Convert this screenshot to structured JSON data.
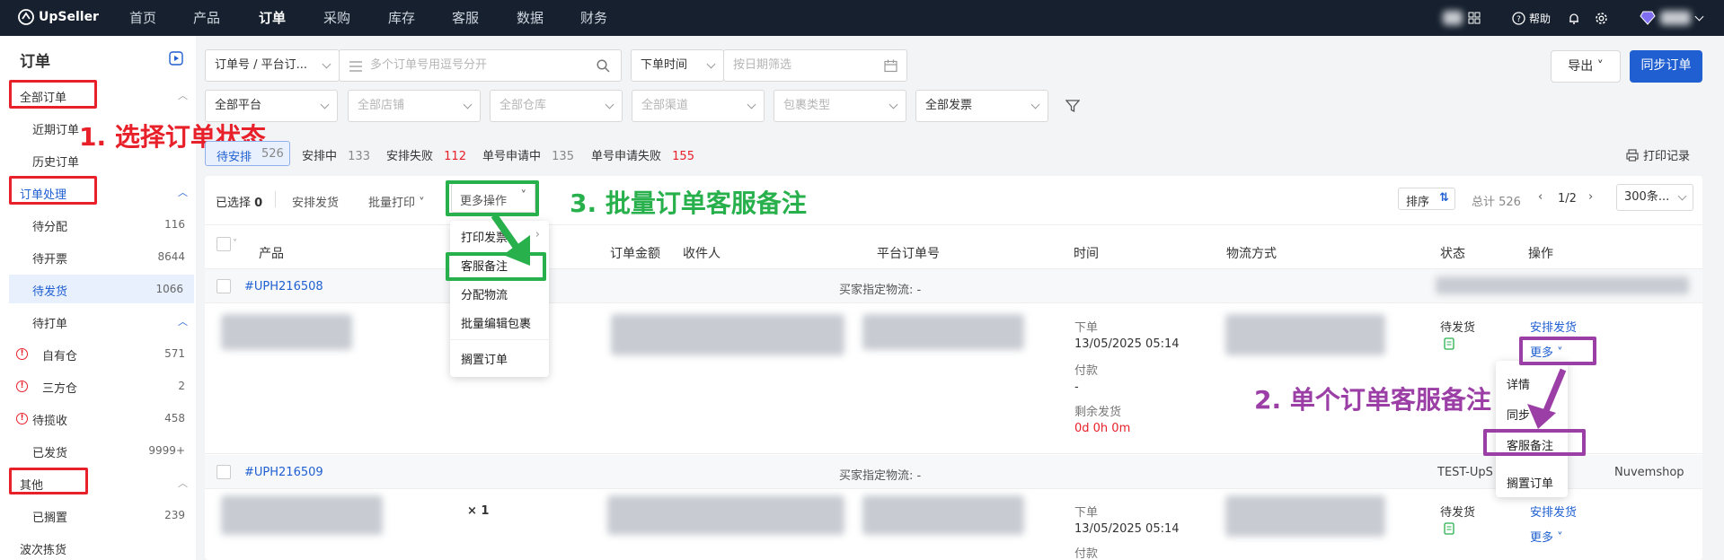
{
  "topbar": {
    "brand": "UpSeller",
    "nav": [
      "首页",
      "产品",
      "订单",
      "采购",
      "库存",
      "客服",
      "数据",
      "财务"
    ],
    "help_label": "帮助"
  },
  "sidebar": {
    "title": "订单",
    "groups": {
      "all_orders": "全部订单",
      "recent": "近期订单",
      "history": "历史订单",
      "processing": "订单处理",
      "to_assign": {
        "label": "待分配",
        "count": "116"
      },
      "to_invoice": {
        "label": "待开票",
        "count": "8644"
      },
      "to_ship": {
        "label": "待发货",
        "count": "1066"
      },
      "to_print": "待打单",
      "own_wh": {
        "label": "自有仓",
        "count": "571"
      },
      "third_wh": {
        "label": "三方仓",
        "count": "2"
      },
      "to_collect": {
        "label": "待揽收",
        "count": "458"
      },
      "shipped": {
        "label": "已发货",
        "count": "9999+"
      },
      "other": "其他",
      "shelved": {
        "label": "已搁置",
        "count": "239"
      },
      "wave_pick": "波次拣货"
    }
  },
  "filters": {
    "order_no_type": "订单号 / 平台订...",
    "order_no_placeholder": "多个订单号用逗号分开",
    "time_type": "下单时间",
    "date_placeholder": "按日期筛选",
    "platform": "全部平台",
    "store": "全部店铺",
    "warehouse": "全部仓库",
    "channel": "全部渠道",
    "package": "包裹类型",
    "invoice": "全部发票",
    "export_label": "导出",
    "sync_label": "同步订单"
  },
  "status_tabs": [
    {
      "label": "待安排",
      "count": "526"
    },
    {
      "label": "安排中",
      "count": "133"
    },
    {
      "label": "安排失败",
      "count": "112"
    },
    {
      "label": "单号申请中",
      "count": "135"
    },
    {
      "label": "单号申请失败",
      "count": "155"
    }
  ],
  "print_log": "打印记录",
  "toolbar": {
    "selected_label": "已选择",
    "selected_count": "0",
    "arrange": "安排发货",
    "batch_print": "批量打印",
    "more_ops": "更多操作",
    "sort": "排序",
    "total": "总计 526",
    "page": "1/2",
    "per_page": "300条..."
  },
  "more_menu": [
    "打印发票",
    "客服备注",
    "分配物流",
    "批量编辑包裹",
    "搁置订单"
  ],
  "columns": [
    "产品",
    "订单金额",
    "收件人",
    "平台订单号",
    "时间",
    "物流方式",
    "状态",
    "操作"
  ],
  "orders": [
    {
      "id": "#UPH216508",
      "buyer_logistics": "买家指定物流: -",
      "time_label1": "下单",
      "order_time": "13/05/2025 05:14",
      "time_label2": "付款",
      "pay_time": "-",
      "time_label3": "剩余发货",
      "remaining": "0d 0h 0m",
      "status": "待发货",
      "action": "安排发货",
      "more": "更多"
    },
    {
      "id": "#UPH216509",
      "buyer_logistics": "买家指定物流: -",
      "qty": "× 1",
      "store_text": "TEST-UpS",
      "platform": "Nuvemshop",
      "time_label1": "下单",
      "order_time": "13/05/2025 05:14",
      "time_label2": "付款",
      "status": "待发货",
      "action": "安排发货",
      "more": "更多"
    }
  ],
  "row_menu": [
    "详情",
    "同步",
    "客服备注",
    "搁置订单"
  ],
  "annotations": {
    "step1": "1. 选择订单状态",
    "step2": "2. 单个订单客服备注",
    "step3": "3. 批量订单客服备注"
  },
  "colors": {
    "topbar": "#16202e",
    "primary": "#1f5fd1",
    "red": "#e8202a",
    "green": "#27b04b",
    "purple": "#9b3fa6"
  }
}
